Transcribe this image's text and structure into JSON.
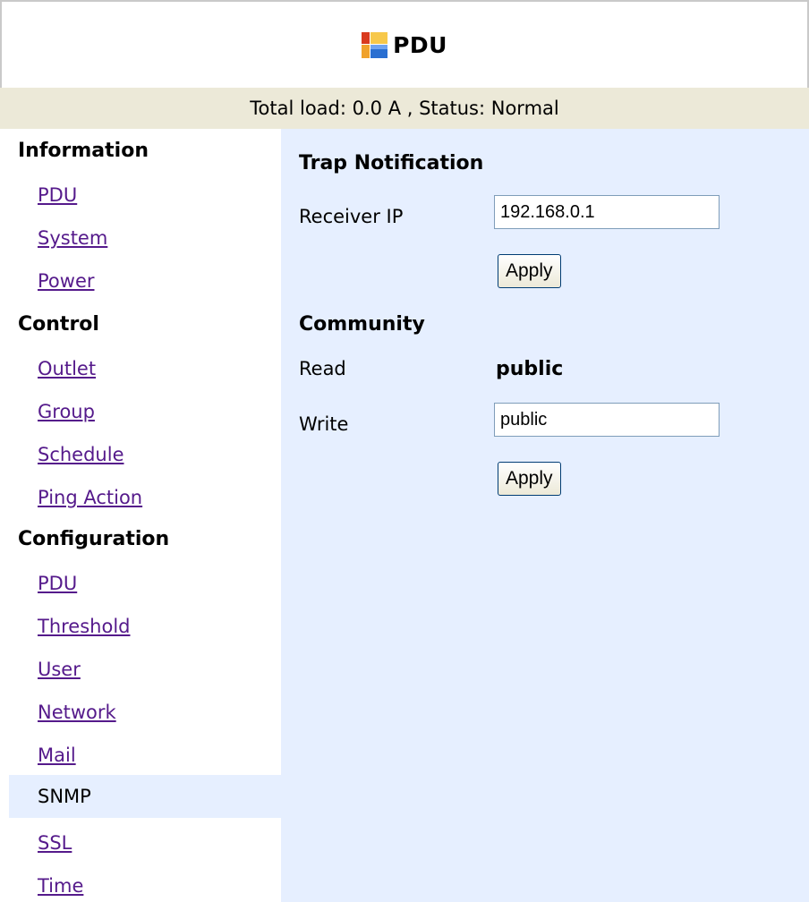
{
  "header": {
    "title": "PDU"
  },
  "status_bar": {
    "text": "Total load: 0.0 A , Status: Normal"
  },
  "sidebar": {
    "sections": [
      {
        "heading": "Information",
        "items": [
          "PDU",
          "System",
          "Power"
        ]
      },
      {
        "heading": "Control",
        "items": [
          "Outlet",
          "Group",
          "Schedule",
          "Ping Action"
        ]
      },
      {
        "heading": "Configuration",
        "items": [
          "PDU",
          "Threshold",
          "User",
          "Network",
          "Mail",
          "SNMP",
          "SSL",
          "Time"
        ]
      }
    ],
    "active_item": "SNMP"
  },
  "trap_notification": {
    "title": "Trap Notification",
    "receiver_ip_label": "Receiver IP",
    "receiver_ip_value": "192.168.0.1",
    "apply_label": "Apply"
  },
  "community": {
    "title": "Community",
    "read_label": "Read",
    "read_value": "public",
    "write_label": "Write",
    "write_value": "public",
    "apply_label": "Apply"
  },
  "colors": {
    "status_bar_bg": "#ece9d8",
    "content_bg": "#e6efff",
    "visited_link": "#551a8b"
  },
  "icons": {
    "logo": "pdu-logo-icon"
  }
}
